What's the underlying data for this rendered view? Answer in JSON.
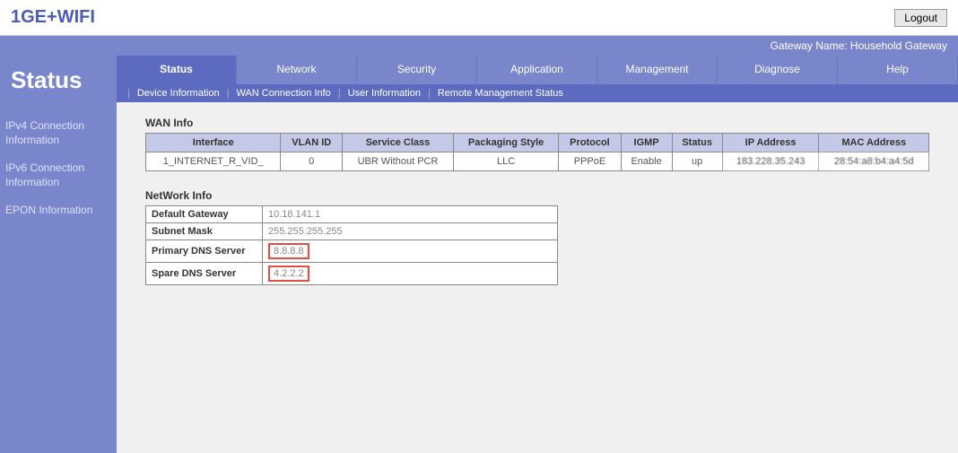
{
  "header": {
    "logo": "1GE+WIFI",
    "logout": "Logout",
    "gateway_label": "Gateway Name: Household Gateway"
  },
  "sidebar": {
    "title": "Status",
    "items": [
      {
        "label": "IPv4 Connection Information"
      },
      {
        "label": "IPv6 Connection Information"
      },
      {
        "label": "EPON Information"
      }
    ]
  },
  "tabs": [
    {
      "label": "Status",
      "active": true
    },
    {
      "label": "Network"
    },
    {
      "label": "Security"
    },
    {
      "label": "Application"
    },
    {
      "label": "Management"
    },
    {
      "label": "Diagnose"
    },
    {
      "label": "Help"
    }
  ],
  "subtabs": [
    {
      "label": "Device Information"
    },
    {
      "label": "WAN Connection Info"
    },
    {
      "label": "User Information"
    },
    {
      "label": "Remote Management Status"
    }
  ],
  "wan": {
    "title": "WAN Info",
    "headers": [
      "Interface",
      "VLAN ID",
      "Service Class",
      "Packaging Style",
      "Protocol",
      "IGMP",
      "Status",
      "IP Address",
      "MAC Address"
    ],
    "row": {
      "interface": "1_INTERNET_R_VID_",
      "vlan": "0",
      "service": "UBR Without PCR",
      "packaging": "LLC",
      "protocol": "PPPoE",
      "igmp": "Enable",
      "status": "up",
      "ip": "183.228.35.243",
      "mac": "28:54:a8:b4:a4:5d"
    }
  },
  "network": {
    "title": "NetWork Info",
    "rows": [
      {
        "label": "Default Gateway",
        "value": "10.18.141.1"
      },
      {
        "label": "Subnet Mask",
        "value": "255.255.255.255"
      },
      {
        "label": "Primary DNS Server",
        "value": "8.8.8.8",
        "highlight": true
      },
      {
        "label": "Spare DNS Server",
        "value": "4.2.2.2",
        "highlight": true
      }
    ]
  }
}
